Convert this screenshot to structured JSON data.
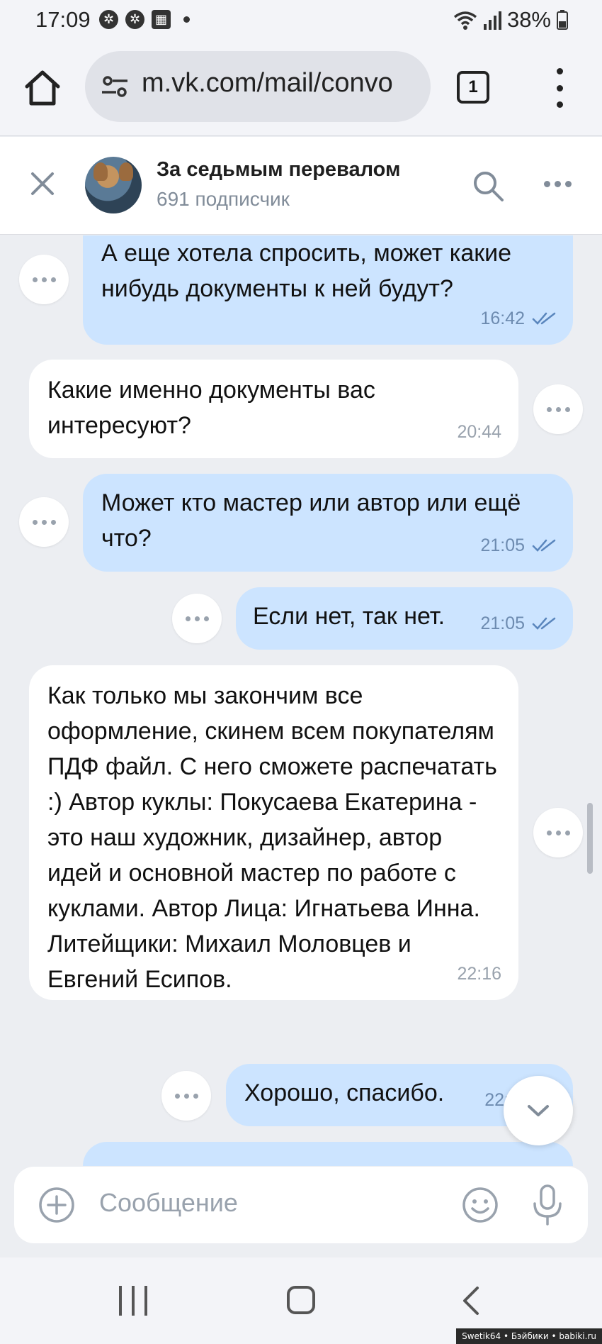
{
  "status_bar": {
    "time": "17:09",
    "battery": "38%"
  },
  "browser": {
    "url": "m.vk.com/mail/convo",
    "tab_count": "1"
  },
  "chat_header": {
    "title": "За седьмым перевалом",
    "subtitle": "691 подписчик"
  },
  "messages": [
    {
      "direction": "out",
      "text": "А еще хотела спросить,  может какие нибудь документы к ней будут?",
      "time": "16:42",
      "read": true
    },
    {
      "direction": "in",
      "text": "Какие именно документы вас интересуют?",
      "time": "20:44"
    },
    {
      "direction": "out",
      "text": "Может кто мастер или автор или ещё что?",
      "time": "21:05",
      "read": true
    },
    {
      "direction": "out",
      "text": "Если нет, так нет.",
      "time": "21:05",
      "read": true
    },
    {
      "direction": "in",
      "text": "Как только мы закончим все оформление, скинем всем покупателям ПДФ файл. С него сможете распечатать :) Автор куклы: Покусаева Екатерина - это наш художник, дизайнер, автор идей и основной мастер по работе с куклами. Автор Лица: Игнатьева Инна. Литейщики: Михаил Моловцев и Евгений Есипов.",
      "time": "22:16"
    },
    {
      "direction": "out",
      "text": "Хорошо,  спасибо.",
      "time": "22:"
    }
  ],
  "composer": {
    "placeholder": "Сообщение"
  },
  "watermark": "Swetik64 • Бэйбики • babiki.ru",
  "colors": {
    "outgoing_bubble": "#cce4ff",
    "incoming_bubble": "#ffffff",
    "background": "#eceef2",
    "time_out": "#6d8bb0",
    "time_in": "#99a2ad"
  }
}
